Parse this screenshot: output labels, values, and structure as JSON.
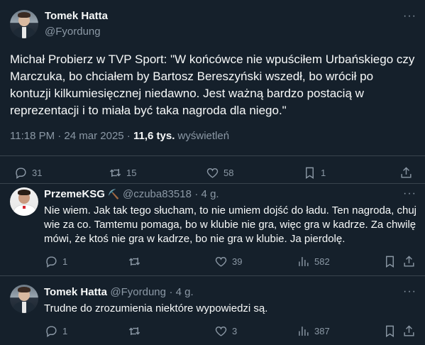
{
  "main_tweet": {
    "author_name": "Tomek Hatta",
    "author_handle": "@Fyordung",
    "text": "Michał Probierz w TVP Sport: \"W końcówce nie wpuściłem Urbańskiego czy Marczuka, bo chciałem by Bartosz Bereszyński wszedł, bo wrócił po kontuzji kilkumiesięcznej niedawno. Jest ważną bardzo postacią w reprezentacji i to miała być taka nagroda dla niego.\"",
    "time": "11:18 PM · 24 mar 2025 ·",
    "views_count": "11,6 tys.",
    "views_label": "wyświetleń",
    "replies": "31",
    "retweets": "15",
    "likes": "58",
    "bookmarks": "1"
  },
  "replies": [
    {
      "author_name": "PrzemeKSG",
      "author_emoji": "⛏️",
      "author_handle": "@czuba83518",
      "age": "· 4 g.",
      "text": "Nie wiem. Jak tak tego słucham, to nie umiem dojść do ładu. Ten nagroda, chuj wie za co. Tamtemu pomaga, bo w klubie nie gra, więc gra w kadrze. Za chwilę mówi, że ktoś nie gra w kadrze, bo nie gra w klubie. Ja pierdolę.",
      "replies": "1",
      "retweets": "",
      "likes": "39",
      "views": "582"
    },
    {
      "author_name": "Tomek Hatta",
      "author_handle": "@Fyordung",
      "age": "· 4 g.",
      "text": "Trudne do zrozumienia niektóre wypowiedzi są.",
      "replies": "1",
      "retweets": "",
      "likes": "3",
      "views": "387"
    }
  ],
  "icons": {
    "more": "more-icon",
    "reply": "reply-icon",
    "retweet": "retweet-icon",
    "like": "heart-icon",
    "bookmark": "bookmark-icon",
    "share": "share-icon",
    "views": "views-icon"
  },
  "colors": {
    "background": "#15202b",
    "text": "#f7f9f9",
    "secondary": "#8b98a5",
    "divider": "#38444d"
  }
}
